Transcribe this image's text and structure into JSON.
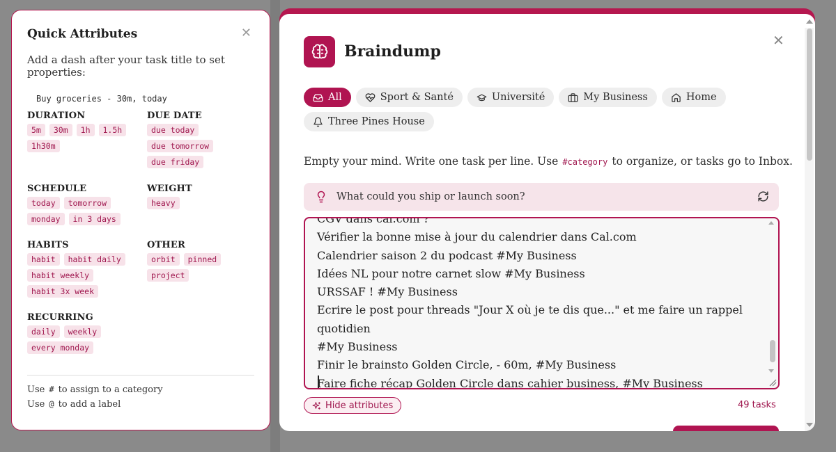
{
  "quick_attributes": {
    "title": "Quick Attributes",
    "intro": "Add a dash after your task title to set properties:",
    "example": "Buy groceries - 30m, today",
    "sections": {
      "duration": {
        "title": "DURATION",
        "chips": [
          "5m",
          "30m",
          "1h",
          "1.5h",
          "1h30m"
        ]
      },
      "due_date": {
        "title": "DUE DATE",
        "chips": [
          "due today",
          "due tomorrow",
          "due friday"
        ]
      },
      "schedule": {
        "title": "SCHEDULE",
        "chips": [
          "today",
          "tomorrow",
          "monday",
          "in 3 days"
        ]
      },
      "weight": {
        "title": "WEIGHT",
        "chips": [
          "heavy"
        ]
      },
      "habits": {
        "title": "HABITS",
        "chips": [
          "habit",
          "habit daily",
          "habit weekly",
          "habit 3x week"
        ]
      },
      "other": {
        "title": "OTHER",
        "chips": [
          "orbit",
          "pinned",
          "project"
        ]
      },
      "recurring": {
        "title": "RECURRING",
        "chips": [
          "daily",
          "weekly",
          "every monday"
        ]
      }
    },
    "footer": {
      "category": {
        "use": "Use",
        "symbol": "#",
        "text": "to assign to a category"
      },
      "label": {
        "use": "Use",
        "symbol": "@",
        "text": "to add a label"
      }
    }
  },
  "braindump": {
    "title": "Braindump",
    "tabs": [
      {
        "label": "All",
        "icon": "inbox-icon",
        "active": true
      },
      {
        "label": "Sport & Santé",
        "icon": "heart-pulse-icon",
        "active": false
      },
      {
        "label": "Université",
        "icon": "graduation-cap-icon",
        "active": false
      },
      {
        "label": "My Business",
        "icon": "briefcase-icon",
        "active": false
      },
      {
        "label": "Home",
        "icon": "home-icon",
        "active": false
      },
      {
        "label": "Three Pines House",
        "icon": "bell-icon",
        "active": false
      }
    ],
    "description": {
      "before": "Empty your mind. Write one task per line. Use",
      "code": "#category",
      "after": "to organize, or tasks go to Inbox."
    },
    "prompt": "What could you ship or launch soon?",
    "editor_lines": [
      "CGV dans cal.com ?",
      "Vérifier la bonne mise à jour du calendrier dans Cal.com",
      "Calendrier saison 2 du podcast #My Business",
      "Idées NL pour notre carnet slow #My Business",
      "URSSAF ! #My Business",
      "Ecrire le post pour threads \"Jour X où je te dis que...\" et me faire un rappel quotidien",
      "#My Business",
      "Finir le brainsto Golden Circle, - 60m, #My Business",
      "Faire fiche récap Golden Circle dans cahier business, #My Business"
    ],
    "hide_attributes_label": "Hide attributes",
    "task_count": "49 tasks",
    "accent_color": "#b01451"
  }
}
